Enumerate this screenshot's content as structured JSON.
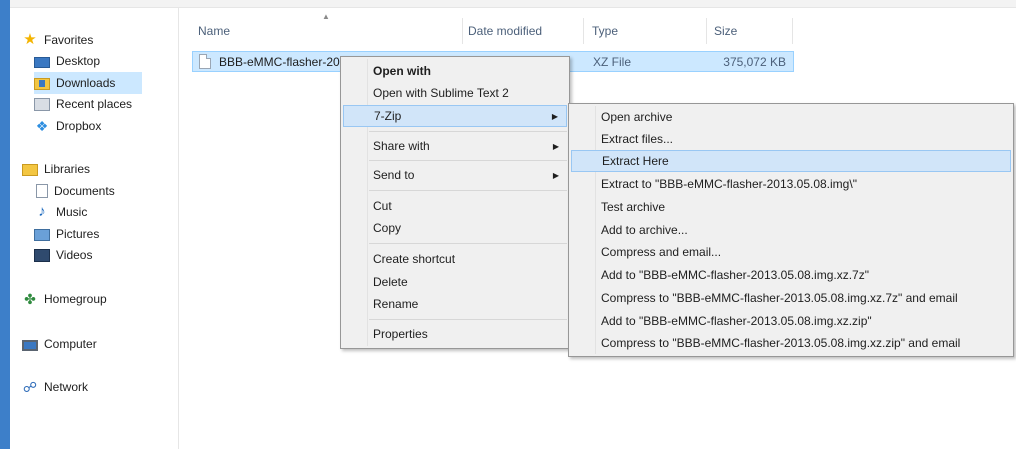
{
  "nav": {
    "favorites_label": "Favorites",
    "favorites": [
      {
        "label": "Desktop",
        "icon": "desktop-icon"
      },
      {
        "label": "Downloads",
        "icon": "downloads-folder-icon",
        "selected": true
      },
      {
        "label": "Recent places",
        "icon": "recent-places-icon"
      },
      {
        "label": "Dropbox",
        "icon": "dropbox-icon"
      }
    ],
    "libraries_label": "Libraries",
    "libraries": [
      {
        "label": "Documents",
        "icon": "documents-icon"
      },
      {
        "label": "Music",
        "icon": "music-icon"
      },
      {
        "label": "Pictures",
        "icon": "pictures-icon"
      },
      {
        "label": "Videos",
        "icon": "videos-icon"
      }
    ],
    "homegroup_label": "Homegroup",
    "computer_label": "Computer",
    "network_label": "Network"
  },
  "columns": {
    "name": "Name",
    "date_modified": "Date modified",
    "type": "Type",
    "size": "Size"
  },
  "file": {
    "name": "BBB-eMMC-flasher-20",
    "type": "XZ File",
    "size": "375,072 KB"
  },
  "context_menu": {
    "items": [
      {
        "label": "Open with",
        "bold": true
      },
      {
        "label": "Open with Sublime Text 2"
      },
      {
        "label": "7-Zip",
        "submenu": true,
        "highlighted": true
      },
      {
        "label": "Share with",
        "submenu": true
      },
      {
        "label": "Send to",
        "submenu": true
      },
      {
        "label": "Cut"
      },
      {
        "label": "Copy"
      },
      {
        "label": "Create shortcut"
      },
      {
        "label": "Delete"
      },
      {
        "label": "Rename"
      },
      {
        "label": "Properties"
      }
    ]
  },
  "submenu_7zip": {
    "items": [
      {
        "label": "Open archive"
      },
      {
        "label": "Extract files..."
      },
      {
        "label": "Extract Here",
        "highlighted": true
      },
      {
        "label": "Extract to \"BBB-eMMC-flasher-2013.05.08.img\\\""
      },
      {
        "label": "Test archive"
      },
      {
        "label": "Add to archive..."
      },
      {
        "label": "Compress and email..."
      },
      {
        "label": "Add to \"BBB-eMMC-flasher-2013.05.08.img.xz.7z\""
      },
      {
        "label": "Compress to \"BBB-eMMC-flasher-2013.05.08.img.xz.7z\" and email"
      },
      {
        "label": "Add to \"BBB-eMMC-flasher-2013.05.08.img.xz.zip\""
      },
      {
        "label": "Compress to \"BBB-eMMC-flasher-2013.05.08.img.xz.zip\" and email"
      }
    ]
  },
  "colors": {
    "selection": "#cce8ff",
    "menu_highlight": "#d1e5f9",
    "window_accent": "#3d7fc9"
  }
}
